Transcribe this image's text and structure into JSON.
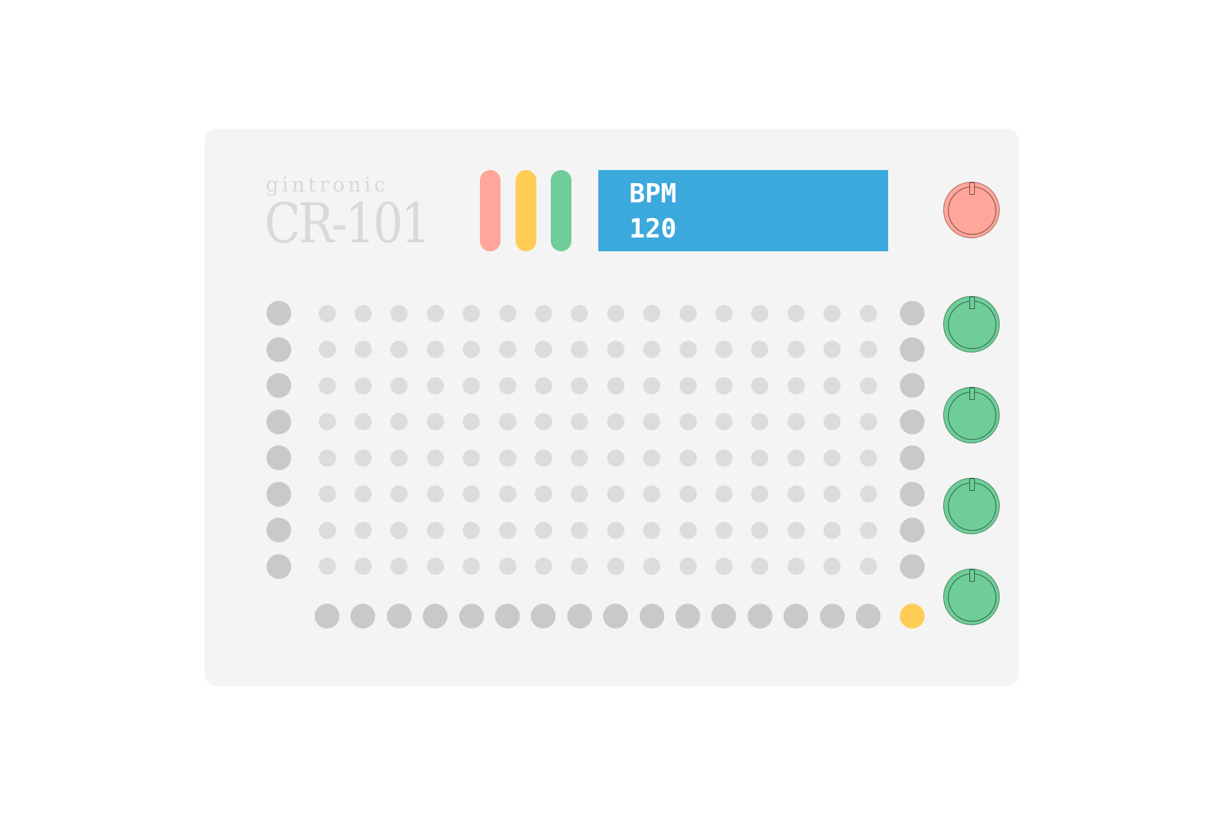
{
  "brand": "gintronic",
  "model": "CR-101",
  "display": {
    "line1": "BPM",
    "line2": "120"
  },
  "colors": {
    "panel": "#f4f4f4",
    "lamp_red": "#ffa59a",
    "lamp_yellow": "#ffcc55",
    "lamp_green": "#6ecd98",
    "lcd": "#3ca9dd",
    "knob_red": "#ffa59a",
    "knob_green": "#6ecd98",
    "pad_large": "#c8c9ca",
    "pad_small": "#dcdcdc",
    "step_active": "#ffcc55"
  },
  "grid": {
    "rows": 8,
    "steps": 16
  },
  "step_buttons": {
    "count": 17,
    "active_index": 16
  },
  "knobs": [
    {
      "name": "master-knob",
      "color": "red",
      "icon": "knob-icon"
    },
    {
      "name": "track-knob-1",
      "color": "green",
      "icon": "knob-icon"
    },
    {
      "name": "track-knob-2",
      "color": "green",
      "icon": "knob-icon"
    },
    {
      "name": "track-knob-3",
      "color": "green",
      "icon": "knob-icon"
    },
    {
      "name": "track-knob-4",
      "color": "green",
      "icon": "knob-icon"
    }
  ]
}
